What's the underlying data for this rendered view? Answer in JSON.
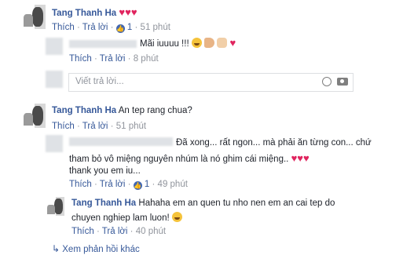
{
  "comments": [
    {
      "author": "Tang Thanh Ha",
      "text": "",
      "actions": {
        "like": "Thích",
        "reply": "Trả lời",
        "like_count": "1",
        "time": "51 phút"
      }
    },
    {
      "author": "",
      "text": "Mãi iuuuu !!!",
      "actions": {
        "like": "Thích",
        "reply": "Trả lời",
        "time": "8 phút"
      }
    },
    {
      "author": "Tang Thanh Ha",
      "text": "An tep rang chua?",
      "actions": {
        "like": "Thích",
        "reply": "Trả lời",
        "time": "51 phút"
      }
    },
    {
      "author": "",
      "text_line1": "Đã xong... rất ngon... mà phải ăn từng con... chứ",
      "text_line2": "tham bỏ vô miệng nguyên nhúm là nó ghim cái miệng..",
      "text_line3": "thank you em iu...",
      "actions": {
        "like": "Thích",
        "reply": "Trả lời",
        "like_count": "1",
        "time": "49 phút"
      }
    },
    {
      "author": "Tang Thanh Ha",
      "text_line1": "Hahaha em an quen tu nho nen em an cai tep do",
      "text_line2": "chuyen nghiep lam luon!",
      "actions": {
        "like": "Thích",
        "reply": "Trả lời",
        "time": "40 phút"
      }
    }
  ],
  "reply_input": {
    "placeholder": "Viết trả lời..."
  },
  "more_replies": "Xem phản hồi khác",
  "icons": [
    "heart-icon",
    "like-icon",
    "laugh-emoji-icon",
    "muscle-emoji-icon",
    "thumbs-up-emoji-icon",
    "camera-icon",
    "smiley-icon",
    "reply-arrow-icon"
  ],
  "colors": {
    "name_link": "#365899",
    "meta": "#90949c",
    "heart": "#e0245e",
    "like_badge": "#4267b2"
  }
}
